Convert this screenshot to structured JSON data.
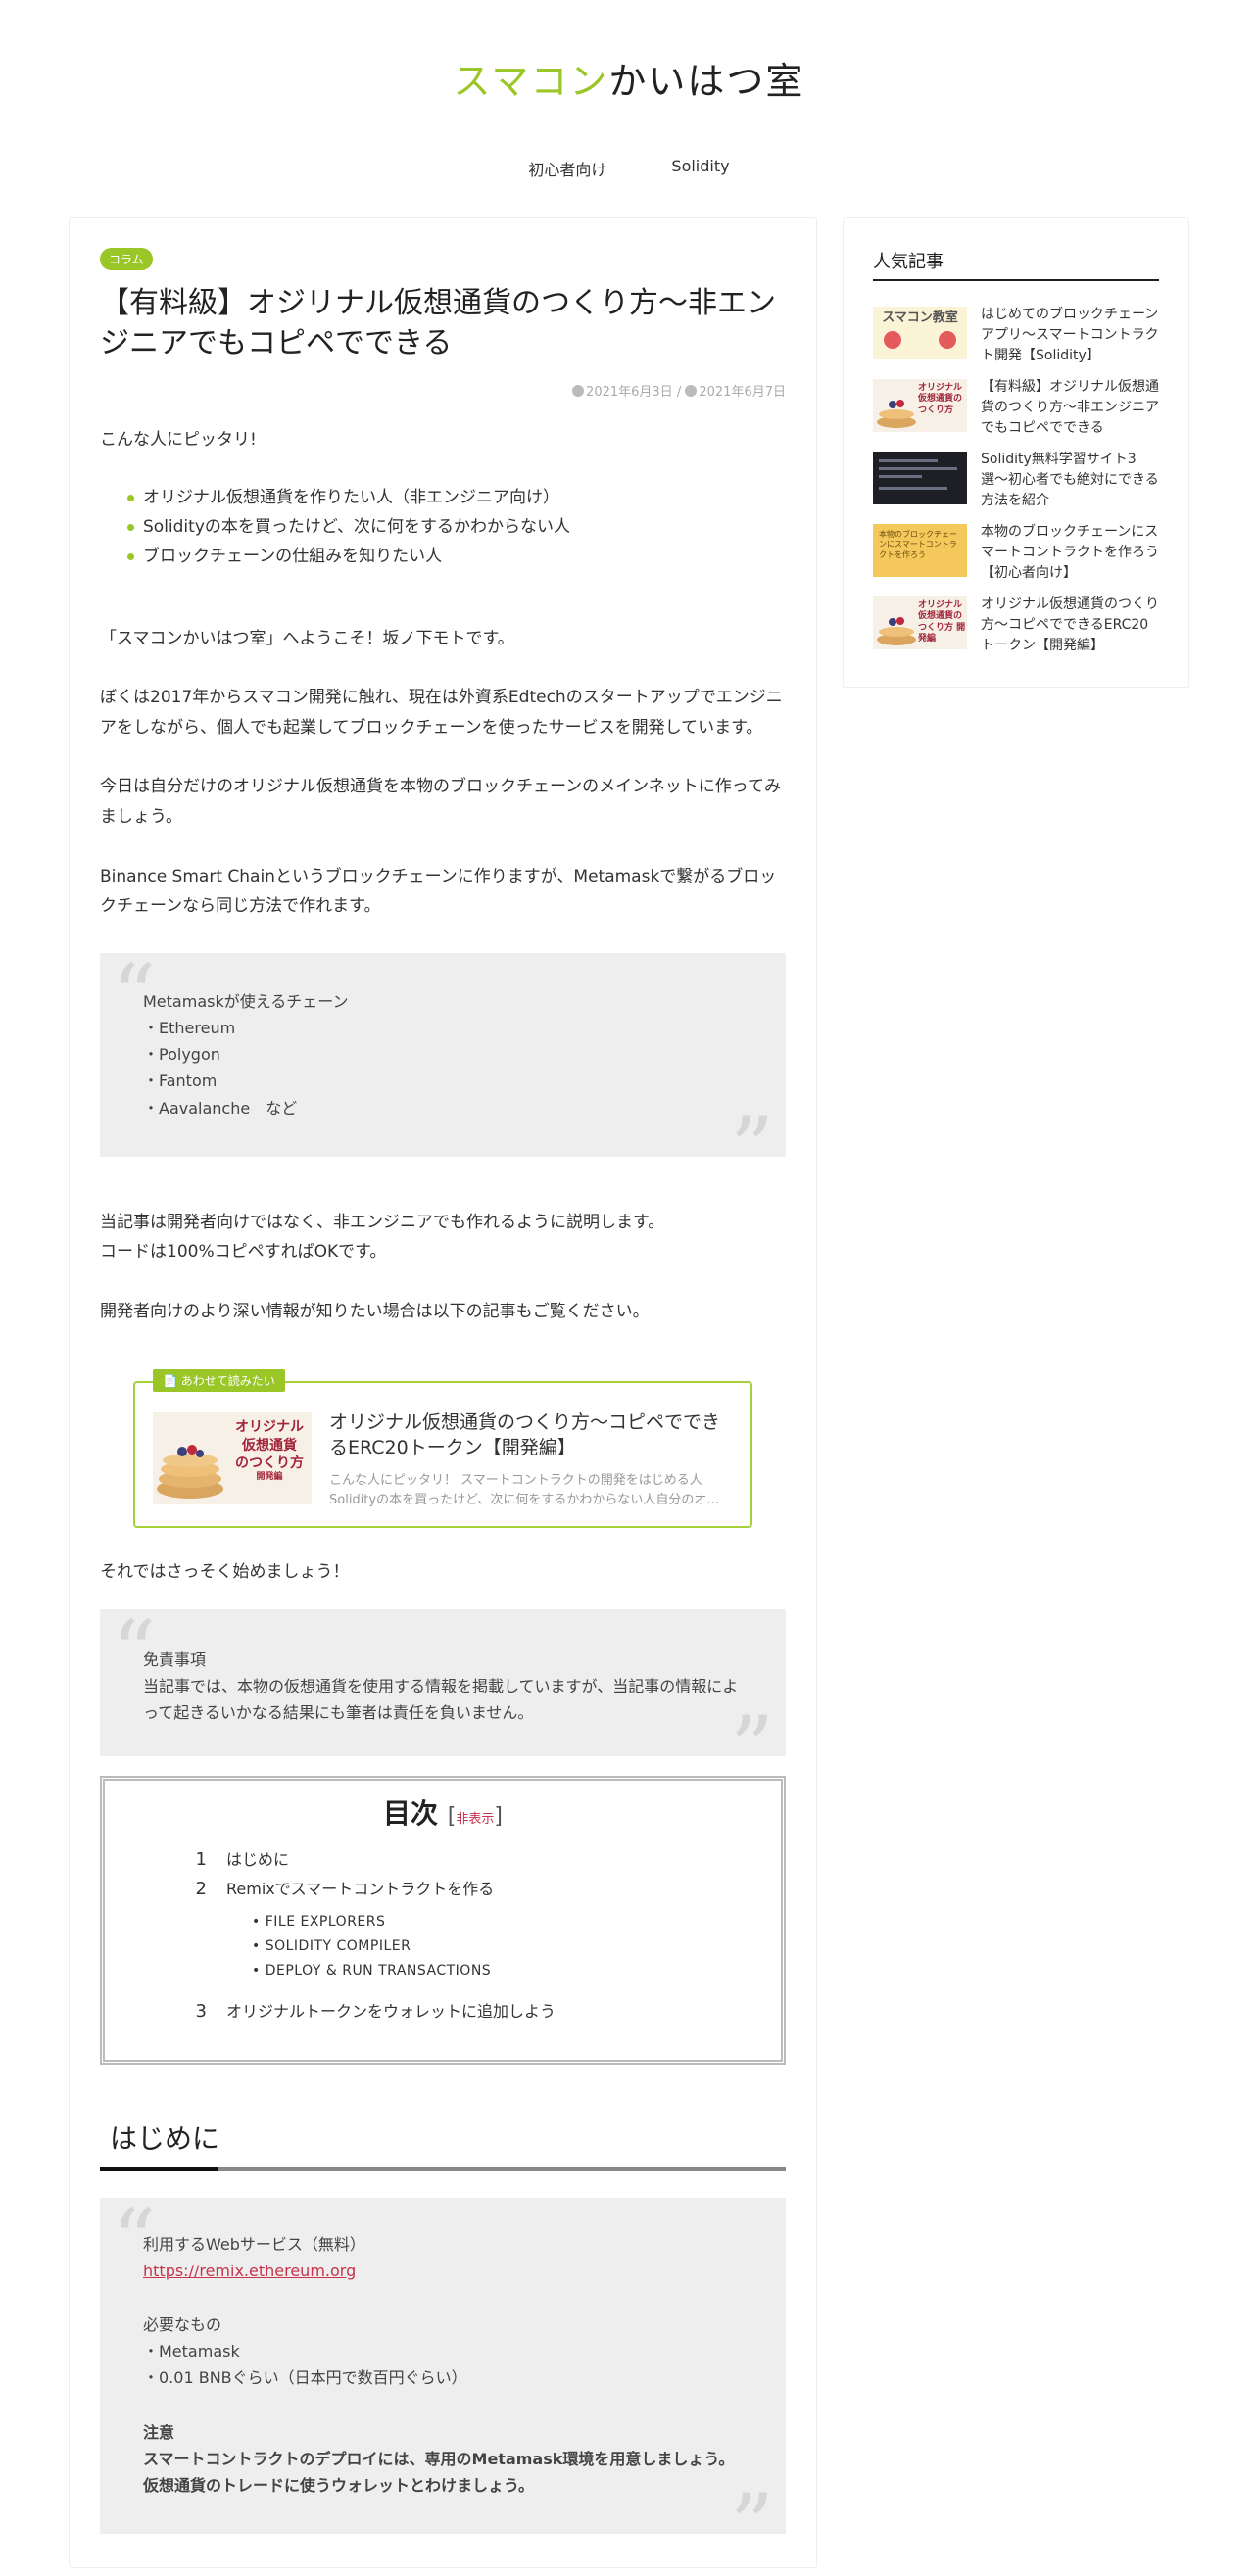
{
  "site": {
    "title_accent": "スマコン",
    "title_rest": "かいはつ室",
    "nav": [
      "初心者向け",
      "Solidity"
    ]
  },
  "article": {
    "category": "コラム",
    "title": "【有料級】オジリナル仮想通貨のつくり方〜非エンジニアでもコピペでできる",
    "published": "2021年6月3日",
    "date_separator": "/",
    "updated": "2021年6月7日",
    "intro": "こんな人にピッタリ!",
    "targets": [
      "オリジナル仮想通貨を作りたい人（非エンジニア向け）",
      "Solidityの本を買ったけど、次に何をするかわからない人",
      "ブロックチェーンの仕組みを知りたい人"
    ],
    "p1": "「スマコンかいはつ室」へようこそ！坂ノ下モトです。",
    "p2": "ぼくは2017年からスマコン開発に触れ、現在は外資系Edtechのスタートアップでエンジニアをしながら、個人でも起業してブロックチェーンを使ったサービスを開発しています。",
    "p3": "今日は自分だけのオリジナル仮想通貨を本物のブロックチェーンのメインネットに作ってみましょう。",
    "p4": "Binance Smart Chainというブロックチェーンに作りますが、Metamaskで繋がるブロックチェーンなら同じ方法で作れます。",
    "quote1": {
      "lines": [
        "Metamaskが使えるチェーン",
        "・Ethereum",
        "・Polygon",
        "・Fantom",
        "・Aavalanche　など"
      ]
    },
    "p5a": "当記事は開発者向けではなく、非エンジニアでも作れるように説明します。",
    "p5b": "コードは100%コピペすればOKです。",
    "p6": "開発者向けのより深い情報が知りたい場合は以下の記事もご覧ください。",
    "related_card": {
      "label": "あわせて読みたい",
      "thumb_lines": [
        "オリジナル",
        "仮想通貨",
        "のつくり方",
        "開発編"
      ],
      "title": "オリジナル仮想通貨のつくり方〜コピペでできるERC20トークン【開発編】",
      "snippet_1": "こんな人にピッタリ！ スマートコントラクトの開発をはじめる人",
      "snippet_2": "Solidityの本を買ったけど、次に何をするかわからない人自分のオ..."
    },
    "p7": "それではさっそく始めましょう！",
    "quote2": {
      "title": "免責事項",
      "body": "当記事では、本物の仮想通貨を使用する情報を掲載していますが、当記事の情報によって起きるいかなる結果にも筆者は責任を負いません。"
    },
    "toc": {
      "title": "目次",
      "bracket_open": "[",
      "toggle": "非表示",
      "bracket_close": "]",
      "items": [
        {
          "num": "1",
          "label": "はじめに"
        },
        {
          "num": "2",
          "label": "Remixでスマートコントラクトを作る"
        },
        {
          "num": "3",
          "label": "オリジナルトークンをウォレットに追加しよう"
        }
      ],
      "subitems": [
        "FILE EXPLORERS",
        "SOLIDITY COMPILER",
        "DEPLOY & RUN TRANSACTIONS"
      ]
    },
    "h2_intro": "はじめに",
    "quote3": {
      "service_label": "利用するWebサービス（無料）",
      "service_link": "https://remix.ethereum.org",
      "needs_label": "必要なもの",
      "needs": [
        "・Metamask",
        "・0.01 BNBぐらい（日本円で数百円ぐらい）"
      ],
      "note_label": "注意",
      "note_body": "スマートコントラクトのデプロイには、専用のMetamask環境を用意しましょう。仮想通貨のトレードに使うウォレットとわけましょう。"
    }
  },
  "sidebar": {
    "title": "人気記事",
    "items": [
      {
        "title": "はじめてのブロックチェーンアプリ〜スマートコントラクト開発【Solidity】",
        "thumb_text": "スマコン教室"
      },
      {
        "title": "【有料級】オジリナル仮想通貨のつくり方〜非エンジニアでもコピペでできる",
        "thumb_text": "オリジナル仮想通貨のつくり方"
      },
      {
        "title": "Solidity無料学習サイト3選〜初心者でも絶対にできる方法を紹介",
        "thumb_text": ""
      },
      {
        "title": "本物のブロックチェーンにスマートコントラクトを作ろう【初心者向け】",
        "thumb_text": "本物のブロックチェーンにスマートコントラクトを作ろう"
      },
      {
        "title": "オリジナル仮想通貨のつくり方〜コピペでできるERC20トークン【開発編】",
        "thumb_text": "オリジナル仮想通貨のつくり方 開発編"
      }
    ]
  },
  "colors": {
    "accent": "#9ac627",
    "link": "#c7334a",
    "quote_bg": "#eeeeee"
  }
}
